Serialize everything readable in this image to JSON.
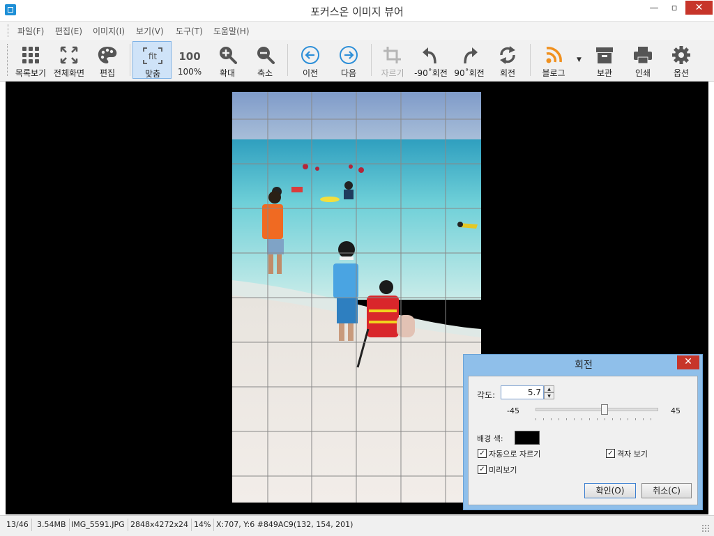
{
  "window": {
    "title": "포커스온 이미지 뷰어"
  },
  "menu": [
    "파일(F)",
    "편집(E)",
    "이미지(I)",
    "보기(V)",
    "도구(T)",
    "도움말(H)"
  ],
  "toolbar": {
    "list": "목록보기",
    "fullscreen": "전체화면",
    "edit": "편집",
    "fit": "맞춤",
    "fit_icon_text": "fit",
    "actual": "100%",
    "actual_icon_text": "100",
    "zoom_in": "확대",
    "zoom_out": "축소",
    "prev": "이전",
    "next": "다음",
    "crop": "자르기",
    "rot_left": "-90˚회전",
    "rot_right": "90˚회전",
    "rotate": "회전",
    "blog": "블로그",
    "archive": "보관",
    "print": "인쇄",
    "options": "옵션"
  },
  "dialog": {
    "title": "회전",
    "angle_label": "각도:",
    "angle_value": "5.7",
    "slider_min": "-45",
    "slider_max": "45",
    "slider_value": 5.7,
    "bg_color_label": "배경 색:",
    "bg_color": "#000000",
    "auto_crop_label": "자동으로 자르기",
    "auto_crop": true,
    "show_grid_label": "격자 보기",
    "show_grid": true,
    "preview_label": "미리보기",
    "preview": true,
    "ok_label": "확인(O)",
    "cancel_label": "취소(C)"
  },
  "status": {
    "index": "13/46",
    "size": "3.54MB",
    "filename": "IMG_5591.JPG",
    "dimensions": "2848x4272x24",
    "zoom": "14%",
    "pixel_info": "X:707, Y:6 #849AC9(132, 154, 201)"
  },
  "colors": {
    "accent": "#1e8fd6",
    "close": "#c7352a",
    "dialog_frame": "#8fbfea"
  }
}
